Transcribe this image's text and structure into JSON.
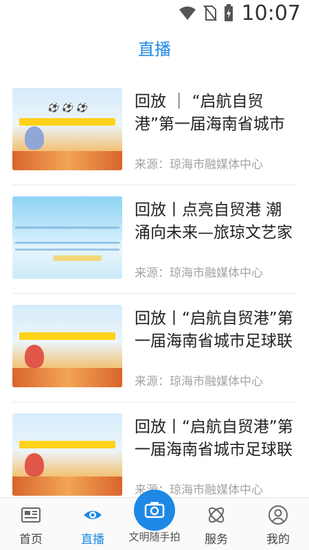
{
  "status_bar": {
    "time": "10:07",
    "icons": [
      "wifi-icon",
      "no-sim-icon",
      "battery-charging-icon"
    ]
  },
  "page": {
    "title": "直播"
  },
  "news": [
    {
      "title": "回放 ｜ “启航自贸港”第一届海南省城市足球联赛",
      "source": "来源：琼海市融媒体中心",
      "thumb_type": "football"
    },
    {
      "title": "回放丨点亮自贸港 潮涌向未来—旅琼文艺家走进红色娘子军纪念园慰问演出",
      "source": "来源：琼海市融媒体中心",
      "thumb_type": "blue"
    },
    {
      "title": "回放丨“启航自贸港”第一届海南省城市足球联赛",
      "source": "来源：琼海市融媒体中心",
      "thumb_type": "football"
    },
    {
      "title": "回放丨“启航自贸港”第一届海南省城市足球联赛",
      "source": "来源：琼海市融媒体中心",
      "thumb_type": "football"
    }
  ],
  "bottom_nav": {
    "items": [
      {
        "label": "首页",
        "icon": "newspaper-icon",
        "active": false
      },
      {
        "label": "直播",
        "icon": "eye-icon",
        "active": true
      },
      {
        "label": "服务",
        "icon": "orbit-icon",
        "active": false
      },
      {
        "label": "我的",
        "icon": "profile-icon",
        "active": false
      }
    ],
    "center": {
      "label": "文明随手拍",
      "icon": "camera-icon"
    }
  },
  "colors": {
    "accent": "#1e88e5",
    "source_text": "#a3a3a3"
  }
}
